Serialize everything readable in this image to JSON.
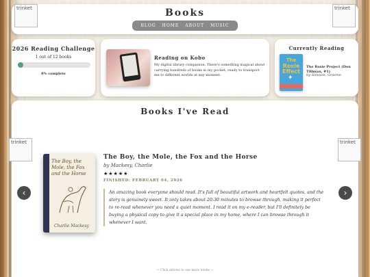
{
  "header": {
    "title": "Books",
    "nav": [
      "BLOG",
      "HOME",
      "ABOUT",
      "MUSIC"
    ],
    "logo_alt_left": "trinket",
    "logo_alt_right": "trinket"
  },
  "challenge": {
    "title": "2026 Reading Challenge",
    "count": "1 out of 12 books",
    "progress_fraction": 0.08,
    "progress_text": "8% complete"
  },
  "kobo": {
    "title": "Reading on Kobo",
    "description": "My digital library companion. There's something magical about carrying hundreds of books in my pocket, ready to transport me to different worlds at any moment."
  },
  "current": {
    "title": "Currently Reading",
    "cover_line1": "The",
    "cover_line2": "Rosie Effect",
    "book_title": "The Rosie Project (Don Tillman, #1)",
    "author": "by Simsion, Graeme"
  },
  "read": {
    "title": "Books I've Read",
    "side_alt_left": "trinket",
    "side_alt_right": "trinket",
    "arrow_left": "‹",
    "arrow_right": "›",
    "book": {
      "cover_title": "The Boy, the Mole, the Fox and the Horse",
      "cover_author": "Charlie Mackesy",
      "title": "The Boy, the Mole, the Fox and the Horse",
      "author": "by Mackesy, Charlie",
      "stars": "★★★★★",
      "finished": "FINISHED: FEBRUARY 04, 2026",
      "review": "An amazing book everyone should read. It's full of beautiful artwork and heartfelt quotes, and the story is genuinely sweet. It only takes about 20-30 minutes to browse through, making it perfect to re-read whenever you need a quiet moment. I read it on my e-reader, but I'll definitely be buying a physical copy to give it a special place in my home, where I can browse through it whenever I want."
    },
    "hint": "← Click arrows to see more books →"
  },
  "colors": {
    "progress": "#5b9a7a",
    "nav_bg": "#8a8a8a",
    "arrow_bg": "#4a4a4a"
  }
}
